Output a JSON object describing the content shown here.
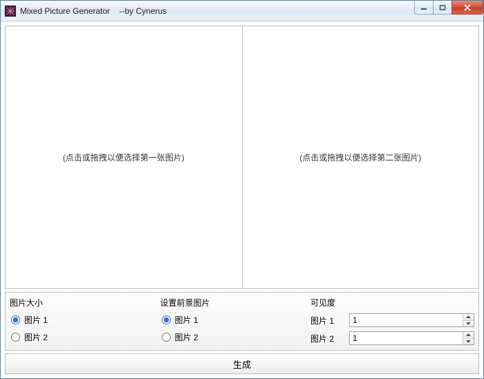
{
  "window": {
    "title": "Mixed Picture Generator    --by Cynerus"
  },
  "drop": {
    "left_hint": "(点击或拖拽以便选择第一张图片)",
    "right_hint": "(点击或拖拽以便选择第二张图片)"
  },
  "options": {
    "size": {
      "title": "图片大小",
      "opt1": "图片 1",
      "opt2": "图片 2",
      "selected": "opt1"
    },
    "fg": {
      "title": "设置前景图片",
      "opt1": "图片 1",
      "opt2": "图片 2",
      "selected": "opt1"
    },
    "visibility": {
      "title": "可见度",
      "label1": "图片 1",
      "label2": "图片 2",
      "value1": "1",
      "value2": "1"
    }
  },
  "buttons": {
    "generate": "生成"
  }
}
